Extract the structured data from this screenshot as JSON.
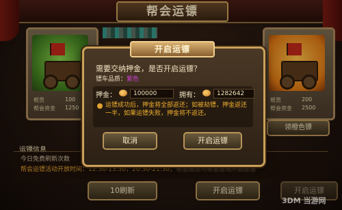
{
  "header": {
    "title": "帮会运镖"
  },
  "cards": {
    "left": {
      "line1_label": "帮贡",
      "line1_value": "100",
      "line2_label": "帮会资金",
      "line2_value": "1250"
    },
    "right": {
      "line1_label": "帮贡",
      "line1_value": "200",
      "line2_label": "帮会资金",
      "line2_value": "2500"
    }
  },
  "buttons": {
    "orange_escort": "领橙色镖",
    "refresh": "10刷新",
    "start_escort_bg": "开启运镖",
    "start_escort_bg2": "开启运镖"
  },
  "info": {
    "label": "运镖信息",
    "free_refresh": "今日免费刷新次数",
    "time_line_start": "帮会运镖活动开放时间：12:30-13:30，20:30-21:30，",
    "time_line_blur": "帮会成员可帮会驻地开启运镖"
  },
  "modal": {
    "title": "开启运镖",
    "question": "需要交纳押金，是否开启运镖？",
    "quality_label": "镖车品质：",
    "quality_value": "紫色",
    "deposit_label": "押金：",
    "deposit_value": "100000",
    "own_label": "拥有：",
    "own_value": "1282642",
    "warning": "运镖成功后，押金将全部返还；如被劫镖，押金返还一半，如果运镖失败，押金将不返还。",
    "cancel": "取消",
    "confirm": "开启运镖"
  },
  "watermark": "3DM 当游网"
}
